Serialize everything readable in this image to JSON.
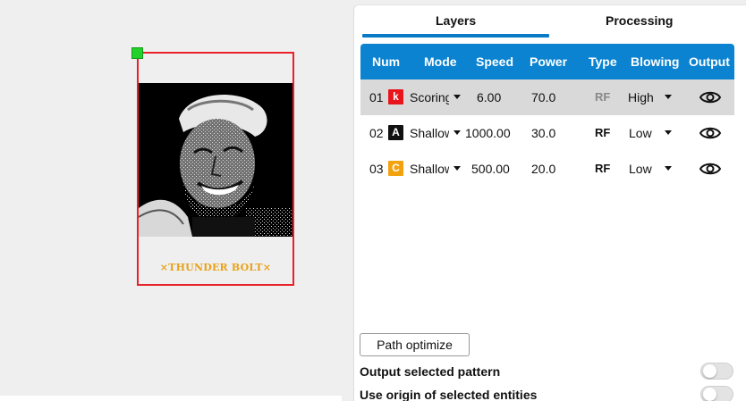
{
  "canvas": {
    "caption": "×THUNDER BOLT×"
  },
  "tabs": [
    {
      "label": "Layers"
    },
    {
      "label": "Processing"
    }
  ],
  "table": {
    "headers": [
      "Num",
      "Mode",
      "Speed",
      "Power",
      "Type",
      "Blowing",
      "Output"
    ],
    "rows": [
      {
        "num": "01",
        "badge": "k",
        "badge_color": "#e8161c",
        "mode": "Scoring",
        "speed": "6.00",
        "power": "70.0",
        "type": "RF",
        "blowing": "High",
        "output_icon": "eye-icon"
      },
      {
        "num": "02",
        "badge": "A",
        "badge_color": "#111111",
        "mode": "Shallow",
        "speed": "1000.00",
        "power": "30.0",
        "type": "RF",
        "blowing": "Low",
        "output_icon": "eye-icon"
      },
      {
        "num": "03",
        "badge": "C",
        "badge_color": "#f2a20f",
        "mode": "Shallow",
        "speed": "500.00",
        "power": "20.0",
        "type": "RF",
        "blowing": "Low",
        "output_icon": "eye-icon"
      }
    ]
  },
  "actions": {
    "path_optimize": "Path optimize"
  },
  "options": {
    "output_selected_pattern": "Output selected pattern",
    "use_origin": "Use origin of selected entities"
  },
  "colors": {
    "accent": "#0b83d0",
    "selection": "#e8222a",
    "handle": "#22d12a",
    "caption": "#e8a21a"
  }
}
